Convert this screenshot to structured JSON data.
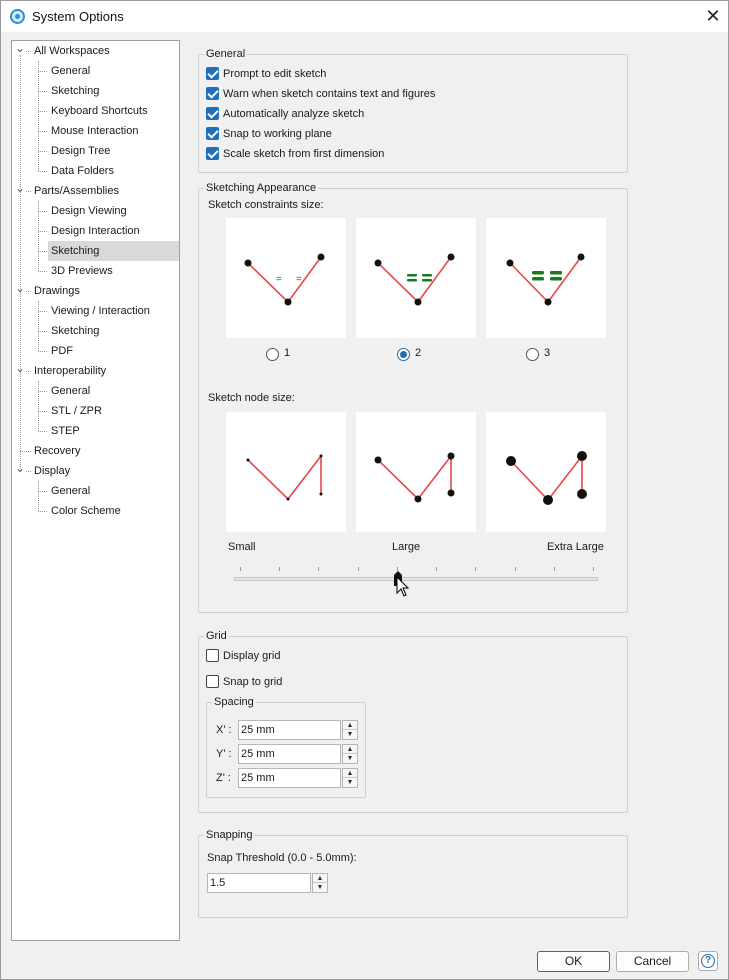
{
  "window": {
    "title": "System Options",
    "close_glyph": "✕"
  },
  "tree": {
    "items": [
      {
        "label": "All Workspaces",
        "level": 0,
        "expanded": true
      },
      {
        "label": "General",
        "level": 1
      },
      {
        "label": "Sketching",
        "level": 1
      },
      {
        "label": "Keyboard Shortcuts",
        "level": 1
      },
      {
        "label": "Mouse Interaction",
        "level": 1
      },
      {
        "label": "Design Tree",
        "level": 1
      },
      {
        "label": "Data Folders",
        "level": 1
      },
      {
        "label": "Parts/Assemblies",
        "level": 0,
        "expanded": true
      },
      {
        "label": "Design Viewing",
        "level": 1
      },
      {
        "label": "Design Interaction",
        "level": 1
      },
      {
        "label": "Sketching",
        "level": 1,
        "selected": true
      },
      {
        "label": "3D Previews",
        "level": 1
      },
      {
        "label": "Drawings",
        "level": 0,
        "expanded": true
      },
      {
        "label": "Viewing / Interaction",
        "level": 1
      },
      {
        "label": "Sketching",
        "level": 1
      },
      {
        "label": "PDF",
        "level": 1
      },
      {
        "label": "Interoperability",
        "level": 0,
        "expanded": true
      },
      {
        "label": "General",
        "level": 1
      },
      {
        "label": "STL / ZPR",
        "level": 1
      },
      {
        "label": "STEP",
        "level": 1
      },
      {
        "label": "Recovery",
        "level": 0
      },
      {
        "label": "Display",
        "level": 0,
        "expanded": true
      },
      {
        "label": "General",
        "level": 1
      },
      {
        "label": "Color Scheme",
        "level": 1
      }
    ]
  },
  "general": {
    "title": "General",
    "options": [
      {
        "label": "Prompt to edit sketch",
        "checked": true
      },
      {
        "label": "Warn when sketch contains text and figures",
        "checked": true
      },
      {
        "label": "Automatically analyze sketch",
        "checked": true
      },
      {
        "label": "Snap to working plane",
        "checked": true
      },
      {
        "label": "Scale sketch from first dimension",
        "checked": true
      }
    ]
  },
  "appearance": {
    "title": "Sketching Appearance",
    "constraints_label": "Sketch constraints size:",
    "constraint_options": [
      {
        "label": "1",
        "selected": false
      },
      {
        "label": "2",
        "selected": true
      },
      {
        "label": "3",
        "selected": false
      }
    ],
    "node_label": "Sketch node size:",
    "slider_labels": {
      "small": "Small",
      "large": "Large",
      "xlarge": "Extra Large"
    },
    "node_size_level": 0.45
  },
  "grid": {
    "title": "Grid",
    "display_grid": {
      "label": "Display grid",
      "checked": false
    },
    "snap_to_grid": {
      "label": "Snap to grid",
      "checked": false
    },
    "spacing": {
      "title": "Spacing",
      "x": {
        "label": "X' :",
        "value": "25 mm"
      },
      "y": {
        "label": "Y' :",
        "value": "25 mm"
      },
      "z": {
        "label": "Z' :",
        "value": "25 mm"
      }
    }
  },
  "snapping": {
    "title": "Snapping",
    "threshold_label": "Snap Threshold (0.0 - 5.0mm):",
    "threshold_value": "1.5"
  },
  "footer": {
    "ok": "OK",
    "cancel": "Cancel",
    "help": "?"
  },
  "colors": {
    "accent": "#1f6fb8",
    "sketch_line": "#e84848",
    "constraint": "#1a7a1a"
  }
}
